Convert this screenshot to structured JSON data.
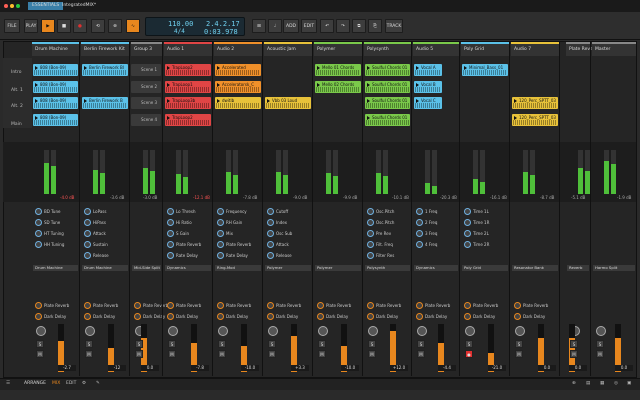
{
  "titlebar": {
    "project_tab": "ESSENTIALS",
    "file_tab": "IntegratedMIX*"
  },
  "toolbar": {
    "file_label": "FILE",
    "play_label": "PLAY",
    "tempo": "110.00",
    "signature": "4/4",
    "position": "2.4.2.17",
    "time": "0:03.978",
    "add_label": "ADD",
    "edit_label": "EDIT",
    "track_label": "TRACK"
  },
  "tracks": [
    {
      "name": "Drum Machine",
      "color": "#5bc1e8"
    },
    {
      "name": "Berlin Firework Kit",
      "color": "#5bc1e8"
    },
    {
      "name": "Group 3",
      "color": "#888888"
    },
    {
      "name": "Audio 1",
      "color": "#e04545"
    },
    {
      "name": "Audio 2",
      "color": "#f0902a"
    },
    {
      "name": "Acoustic Jam",
      "color": "#e8c23a"
    },
    {
      "name": "Polymer",
      "color": "#7ac94a"
    },
    {
      "name": "Polysynth",
      "color": "#7ac94a"
    },
    {
      "name": "Audio 5",
      "color": "#7ac94a"
    },
    {
      "name": "Poly Grid",
      "color": "#5bc1e8"
    },
    {
      "name": "Audio 7",
      "color": "#e8c23a"
    },
    {
      "name": "Plate Reve",
      "color": "#888888"
    },
    {
      "name": "Master",
      "color": "#888888"
    }
  ],
  "scenes": [
    "Intro",
    "Alt. 1",
    "Alt. 2",
    "Main"
  ],
  "scene_buttons": [
    "Scene 1",
    "Scene 2",
    "Scene 3",
    "Scene 4"
  ],
  "clips": {
    "dm1": "808 (Bon-09)",
    "dm2": "808 (Bon-09)",
    "dm3": "808 (Bon-09)",
    "dm4": "808 (Bon-09)",
    "bf1": "Berlin Firework Bl",
    "bf2": "Berlin Firework B",
    "a1a": "TrapLoop1",
    "a1b": "TrapLoop2",
    "a1c": "TrapLoop3b",
    "a1d": "TrapLoop2",
    "a2a": "Accelerated",
    "a2b": "Acceleratorsk_C",
    "a2c": "dwitlb",
    "aj1": "Vbb 03 Loud",
    "pm1": "Mello 01 Chords",
    "pm2": "Mello 02 Chords",
    "ps1": "Soulful Chords 01",
    "ps2": "Soulful Chords 01",
    "ps3": "Soulful Chords 01",
    "ps4": "Soulful Chords 01",
    "a5a": "Vocal A",
    "a5b": "Vocal B",
    "a5c": "Vocal C",
    "pg1": "Minimal_Bass_01",
    "a7a": "120_Perc_SPTT_03",
    "a7b": "120_Perc_SPTT_03"
  },
  "db_values": [
    "-4.0 dB",
    "-3.6 dB",
    "-3.0 dB",
    "-12.1 dB",
    "-7.8 dB",
    "-9.0 dB",
    "-9.9 dB",
    "-10.1 dB",
    "-20.3 dB",
    "-16.1 dB",
    "-8.7 dB",
    "-5.1 dB",
    "-1.9 dB"
  ],
  "remote_controls": {
    "c1": [
      "BD Tune",
      "SD Tune",
      "HT Tuning",
      "HH Tuning"
    ],
    "c2": [
      "LoPass",
      "HiPass",
      "Attack",
      "Sustain",
      "Release"
    ],
    "c4": [
      "Lo Thresh",
      "Hi Ratio",
      "S Gain",
      "Plate Reverb",
      "Rate Delay"
    ],
    "c5": [
      "Frequency",
      "RH Gain",
      "Mix",
      "Plate Reverb",
      "Rate Delay"
    ],
    "c6": [
      "Cutoff",
      "Index",
      "Osc Sub",
      "Attack",
      "Release"
    ],
    "c8": [
      "Osc.Pitch",
      "Osc.Pitch",
      "Pre Rev",
      "Filt. Freq",
      "Filter Res"
    ],
    "c9": [
      "1 Freq",
      "2 Freq",
      "3 Freq",
      "4 Freq"
    ],
    "c10": [
      "Time 1L",
      "Time 1R",
      "Time 2L",
      "Time 2R"
    ]
  },
  "devices": [
    "Drum Machine",
    "Drum Machine",
    "Mid-Side Split",
    "Dynamics",
    "Ring-Mod",
    "Polymer",
    "Polymer",
    "Polysynth",
    "Dynamics",
    "Poly Grid",
    "Resonator Bank",
    "Reverb",
    "Harmo Split"
  ],
  "sends": {
    "reverb": "Plate Reverb",
    "delay": "Dark Delay"
  },
  "volumes": [
    "-2.7",
    "-12",
    "0.0",
    "-7.8",
    "-10.0",
    "+3.3",
    "-10.0",
    "+12.0",
    "-4.4",
    "-21.0",
    "0.0",
    "0.0",
    "0.0"
  ],
  "status": {
    "arrange": "ARRANGE",
    "mix": "MIX",
    "edit": "EDIT"
  },
  "accent": "#e8871e"
}
